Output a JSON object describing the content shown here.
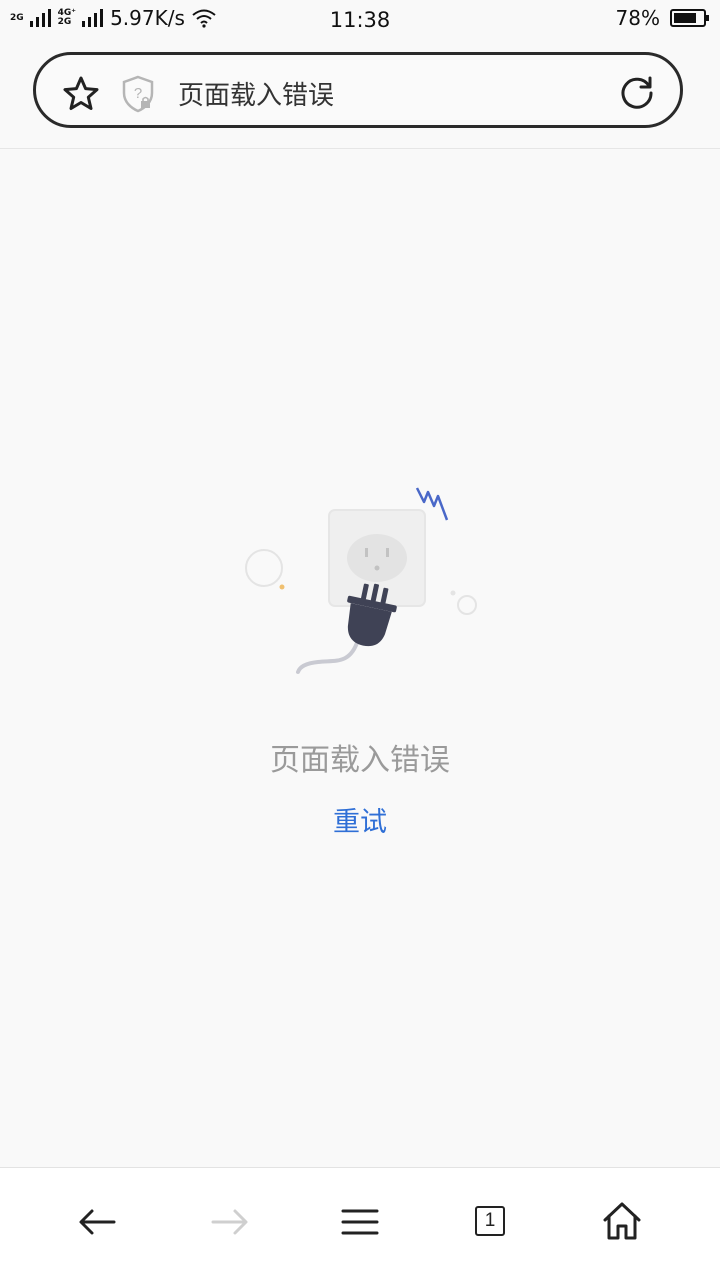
{
  "status_bar": {
    "net1": "2G",
    "net2a": "4G⁺",
    "net2b": "2G",
    "speed": "5.97K/s",
    "time": "11:38",
    "battery": "78%"
  },
  "address_bar": {
    "title": "页面载入错误"
  },
  "error": {
    "message": "页面载入错误",
    "retry_label": "重试"
  },
  "bottom_nav": {
    "tab_count": "1"
  },
  "colors": {
    "accent": "#2f6fd6",
    "plug": "#3f4255",
    "spark": "#4a68c8"
  },
  "icons": [
    "star-icon",
    "shield-question-icon",
    "reload-icon",
    "back-arrow-icon",
    "forward-arrow-icon",
    "menu-icon",
    "tabs-icon",
    "home-icon"
  ]
}
